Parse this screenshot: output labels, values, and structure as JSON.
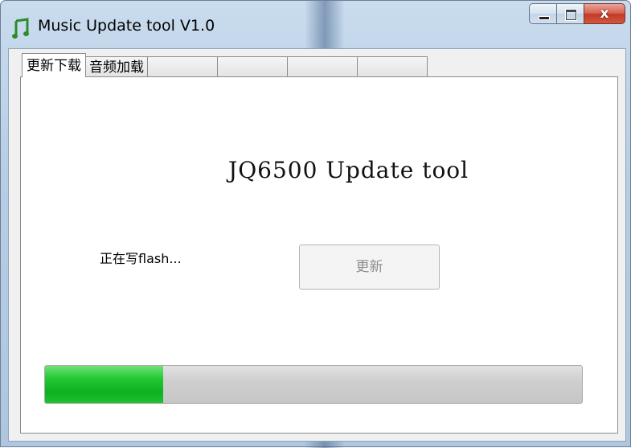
{
  "window": {
    "title": "Music Update tool V1.0",
    "close_glyph": "x",
    "icon": "music-note-icon"
  },
  "tabs": [
    {
      "label": "更新下载",
      "active": true
    },
    {
      "label": "音频加载",
      "active": false
    },
    {
      "label": "",
      "active": false
    },
    {
      "label": "",
      "active": false
    },
    {
      "label": "",
      "active": false
    },
    {
      "label": "",
      "active": false
    }
  ],
  "main": {
    "heading": "JQ6500 Update tool",
    "status": "正在写flash...",
    "update_button": "更新",
    "progress_fraction": 0.22
  },
  "colors": {
    "progress_fill": "#1cc22c",
    "close_button": "#c23a25"
  }
}
